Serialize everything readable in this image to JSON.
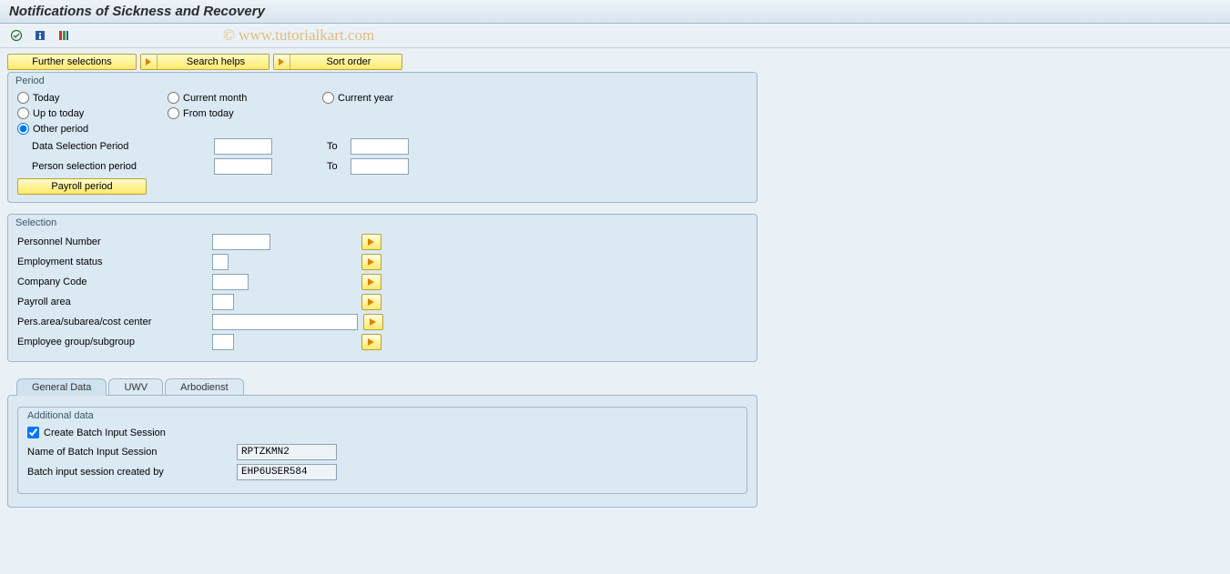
{
  "title": "Notifications of Sickness and Recovery",
  "watermark": "© www.tutorialkart.com",
  "toolbar_buttons": {
    "further_selections": "Further selections",
    "search_helps": "Search helps",
    "sort_order": "Sort order"
  },
  "period": {
    "legend": "Period",
    "today": "Today",
    "current_month": "Current month",
    "current_year": "Current year",
    "up_to_today": "Up to today",
    "from_today": "From today",
    "other_period": "Other period",
    "selected": "other_period",
    "data_selection_period": "Data Selection Period",
    "person_selection_period": "Person selection period",
    "to": "To",
    "payroll_period": "Payroll period",
    "values": {
      "data_from": "",
      "data_to": "",
      "person_from": "",
      "person_to": ""
    }
  },
  "selection": {
    "legend": "Selection",
    "personnel_number": "Personnel Number",
    "employment_status": "Employment status",
    "company_code": "Company Code",
    "payroll_area": "Payroll area",
    "pers_area": "Pers.area/subarea/cost center",
    "employee_group": "Employee group/subgroup",
    "values": {
      "personnel_number": "",
      "employment_status": "",
      "company_code": "",
      "payroll_area": "",
      "pers_area": "",
      "employee_group": ""
    }
  },
  "tabs": {
    "general": "General Data",
    "uwv": "UWV",
    "arbodienst": "Arbodienst"
  },
  "additional_data": {
    "legend": "Additional data",
    "create_batch": "Create Batch Input Session",
    "create_batch_checked": true,
    "session_name_label": "Name of Batch Input Session",
    "session_name": "RPTZKMN2",
    "created_by_label": "Batch input session created by",
    "created_by": "EHP6USER584"
  }
}
